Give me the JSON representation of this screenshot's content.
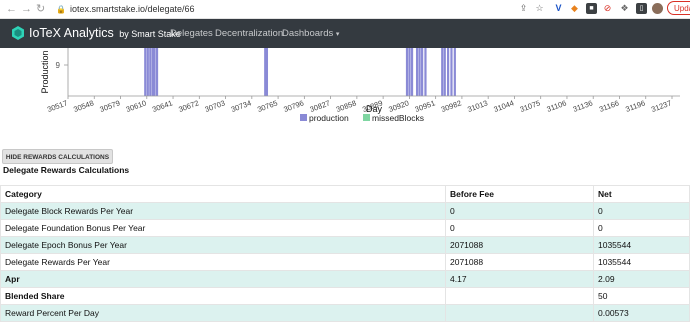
{
  "browser": {
    "url": "iotex.smartstake.io/delegate/66",
    "update_label": "Upda"
  },
  "navbar": {
    "brand": "IoTeX Analytics",
    "brand_suffix": "by Smart Stake",
    "links": [
      "Delegates",
      "Decentralization",
      "Dashboards"
    ]
  },
  "chart_data": {
    "type": "bar",
    "xlabel": "Day",
    "ylabel": "Production",
    "y_tick_visible": "9",
    "x_ticks": [
      "30517",
      "30548",
      "30579",
      "30610",
      "30641",
      "30672",
      "30703",
      "30734",
      "30765",
      "30796",
      "30827",
      "30858",
      "30889",
      "30920",
      "30951",
      "30982",
      "31013",
      "31044",
      "31075",
      "31106",
      "31136",
      "31166",
      "31196",
      "31237"
    ],
    "xlim": [
      30517,
      31237
    ],
    "series": [
      {
        "name": "production",
        "color": "#8a8ad6",
        "days": [
          30609,
          30612,
          30615,
          30618,
          30620,
          30623,
          30752,
          30754,
          30921,
          30924,
          30927,
          30933,
          30936,
          30939,
          30943,
          30963,
          30966,
          30970,
          30974,
          30978
        ]
      },
      {
        "name": "missedBlocks",
        "color": "#7fd6a2",
        "days": []
      }
    ]
  },
  "rewards": {
    "hide_button": "HIDE REWARDS CALCULATIONS",
    "title": "Delegate Rewards Calculations",
    "headers": [
      "Category",
      "Before Fee",
      "Net"
    ],
    "rows": [
      [
        "Delegate Block Rewards Per Year",
        "0",
        "0"
      ],
      [
        "Delegate Foundation Bonus Per Year",
        "0",
        "0"
      ],
      [
        "Delegate Epoch Bonus Per Year",
        "2071088",
        "1035544"
      ],
      [
        "Delegate Rewards Per Year",
        "2071088",
        "1035544"
      ],
      [
        "Apr",
        "4.17",
        "2.09"
      ],
      [
        "Blended Share",
        "",
        "50"
      ],
      [
        "Reward Percent Per Day",
        "",
        "0.00573"
      ]
    ]
  }
}
